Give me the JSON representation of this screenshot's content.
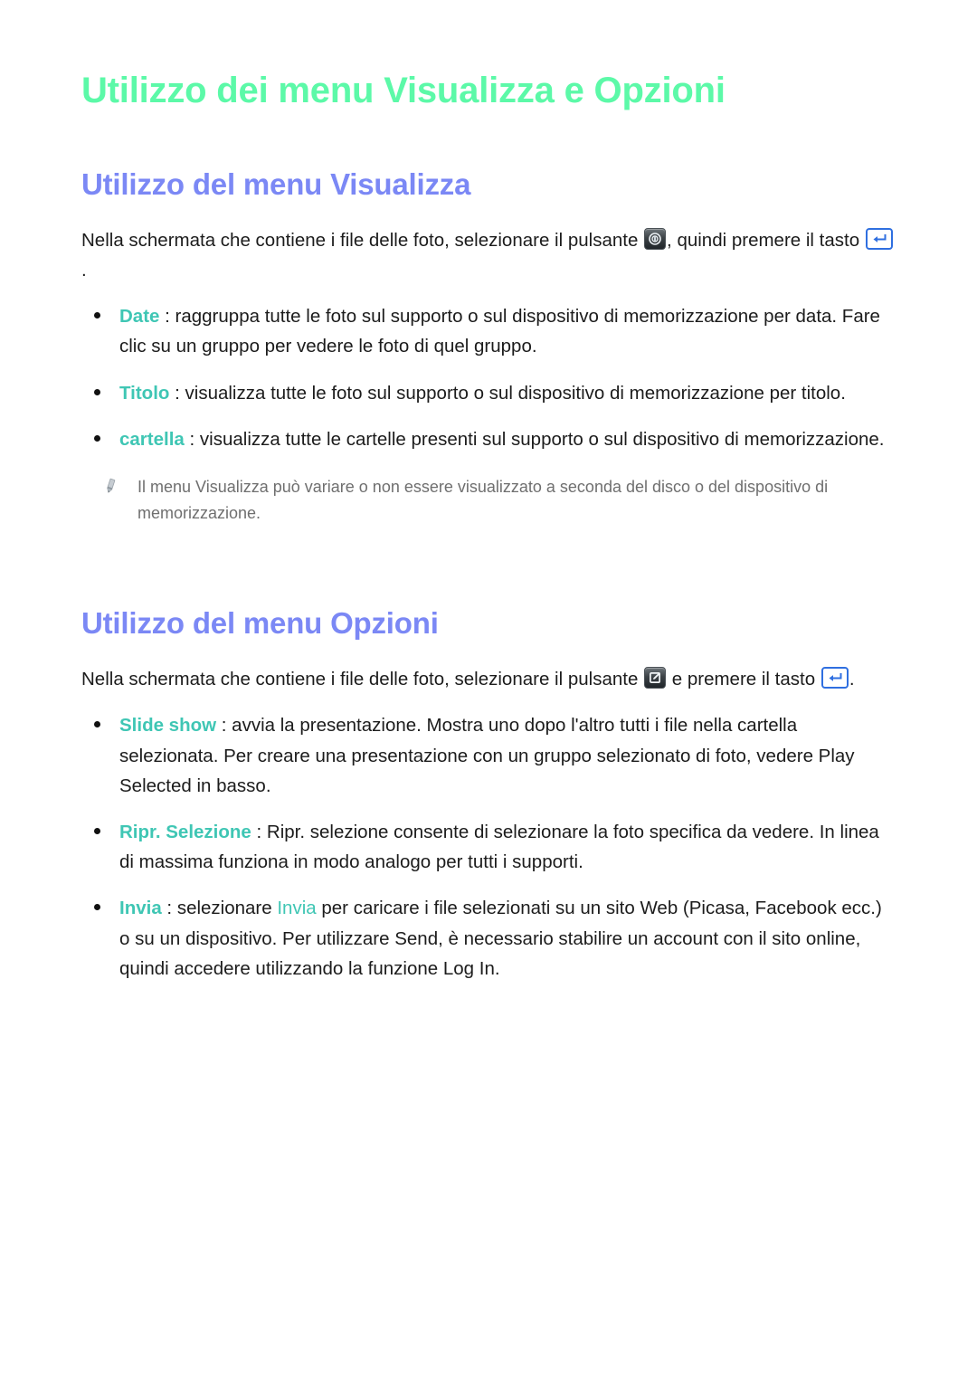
{
  "page": {
    "title": "Utilizzo dei menu Visualizza e Opzioni",
    "colors": {
      "title_green": "#5CF9A8",
      "section_blue": "#7B88F5",
      "keyword_teal": "#3FC6B4",
      "body_black": "#1C1C1C",
      "note_grey": "#6F6F6F",
      "key_border_blue": "#2F6FE0"
    }
  },
  "sections": [
    {
      "heading": "Utilizzo del menu Visualizza",
      "intro": {
        "part1": "Nella schermata che contiene i file delle foto, selezionare il pulsante ",
        "icon1": "view-button-icon",
        "part2": ", quindi premere il tasto ",
        "icon2": "enter-key-icon",
        "part3": "."
      },
      "bullets": [
        {
          "keyword": "Date",
          "separator": " : ",
          "text": "raggruppa tutte le foto sul supporto o sul dispositivo di memorizzazione per data. Fare clic su un gruppo per vedere le foto di quel gruppo."
        },
        {
          "keyword": "Titolo",
          "separator": " : ",
          "text": "visualizza tutte le foto sul supporto o sul dispositivo di memorizzazione per titolo."
        },
        {
          "keyword": "cartella",
          "separator": " : ",
          "text": "visualizza tutte le cartelle presenti sul supporto o sul dispositivo di memorizzazione."
        }
      ],
      "note": {
        "icon": "pencil-icon",
        "text": "Il menu Visualizza può variare o non essere visualizzato a seconda del disco o del dispositivo di memorizzazione."
      }
    },
    {
      "heading": "Utilizzo del menu Opzioni",
      "intro": {
        "part1": "Nella schermata che contiene i file delle foto, selezionare il pulsante ",
        "icon1": "options-edit-button-icon",
        "part2": " e premere il tasto ",
        "icon2": "enter-key-icon",
        "part3": "."
      },
      "bullets": [
        {
          "keyword": "Slide show",
          "separator": " : ",
          "text": "avvia la presentazione. Mostra uno dopo l'altro tutti i file nella cartella selezionata. Per creare una presentazione con un gruppo selezionato di foto, vedere Play Selected in basso."
        },
        {
          "keyword": "Ripr. Selezione",
          "separator": " : ",
          "text": "Ripr. selezione consente di selezionare la foto specifica da vedere. In linea di massima funziona in modo analogo per tutti i supporti."
        },
        {
          "keyword": "Invia",
          "separator": " : ",
          "text_before": "selezionare ",
          "inline_keyword": "Invia",
          "text_after": " per caricare i file selezionati su un sito Web (Picasa, Facebook ecc.) o su un dispositivo. Per utilizzare Send, è necessario stabilire un account con il sito online, quindi accedere utilizzando la funzione Log In."
        }
      ]
    }
  ]
}
